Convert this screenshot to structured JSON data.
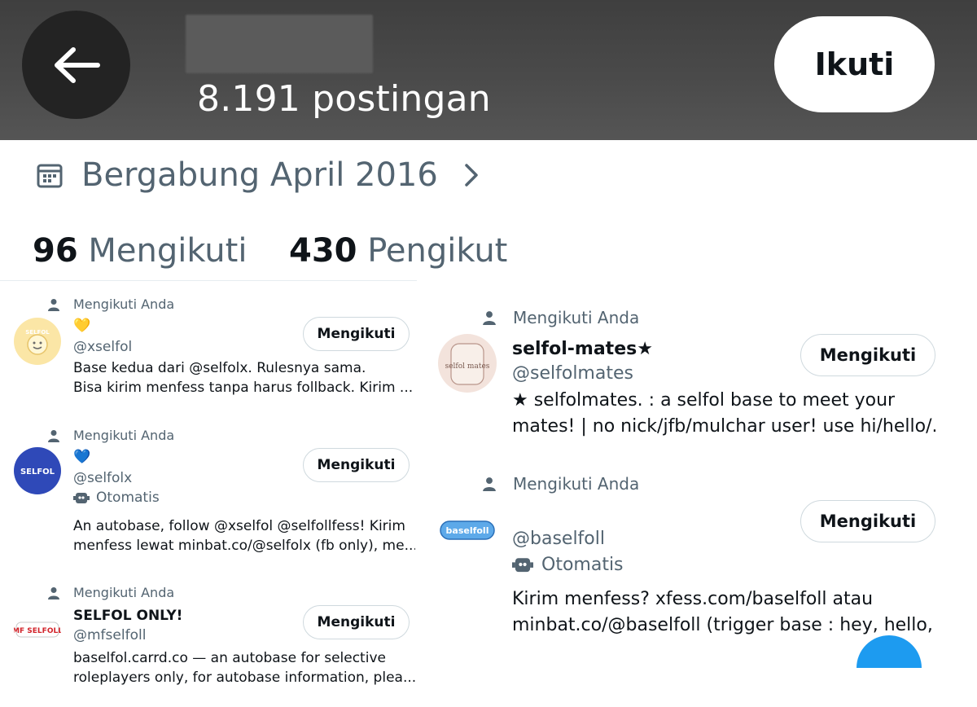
{
  "header": {
    "post_count": "8.191 postingan",
    "follow_label": "Ikuti"
  },
  "profile": {
    "joined": "Bergabung April 2016",
    "following_count": "96",
    "following_label": "Mengikuti",
    "followers_count": "430",
    "followers_label": "Pengikut"
  },
  "follows_you_label": "Mengikuti Anda",
  "follow_button_label": "Mengikuti",
  "automated_label": "Otomatis",
  "accounts_left": [
    {
      "name": "💛",
      "handle": "@xselfol",
      "bio_line1": "Base kedua dari @selfolx. Rulesnya sama.",
      "bio_line2": "Bisa kirim menfess tanpa harus follback. Kirim ..."
    },
    {
      "name": "💙",
      "handle": "@selfolx",
      "bio_line1": "An autobase, follow @xselfol @selfollfess! Kirim",
      "bio_line2": "menfess lewat minbat.co/@selfolx (fb only), me..."
    },
    {
      "name": "SELFOL ONLY!",
      "handle": "@mfselfoll",
      "bio_line1": "baselfol.carrd.co — an autobase for selective",
      "bio_line2": "roleplayers only, for autobase information, plea..."
    }
  ],
  "accounts_right": [
    {
      "name": "selfol-mates★",
      "handle": "@selfolmates",
      "bio_line1": "★ selfolmates.   : a selfol base to meet your",
      "bio_line2": "mates! | no nick/jfb/mulchar user! use hi/hello/..."
    },
    {
      "name": "",
      "handle": "@baselfoll",
      "bio_line1": "Kirim menfess? xfess.com/baselfoll atau",
      "bio_line2": "minbat.co/@baselfoll (trigger base : hey, hello, ..."
    }
  ],
  "avatars": {
    "xselfol": "SELFOL",
    "selfolx": "SELFOL",
    "mfselfoll": "MF SELFOLL",
    "selfolmates": "selfol mates",
    "baselfoll": "baselfoll"
  }
}
